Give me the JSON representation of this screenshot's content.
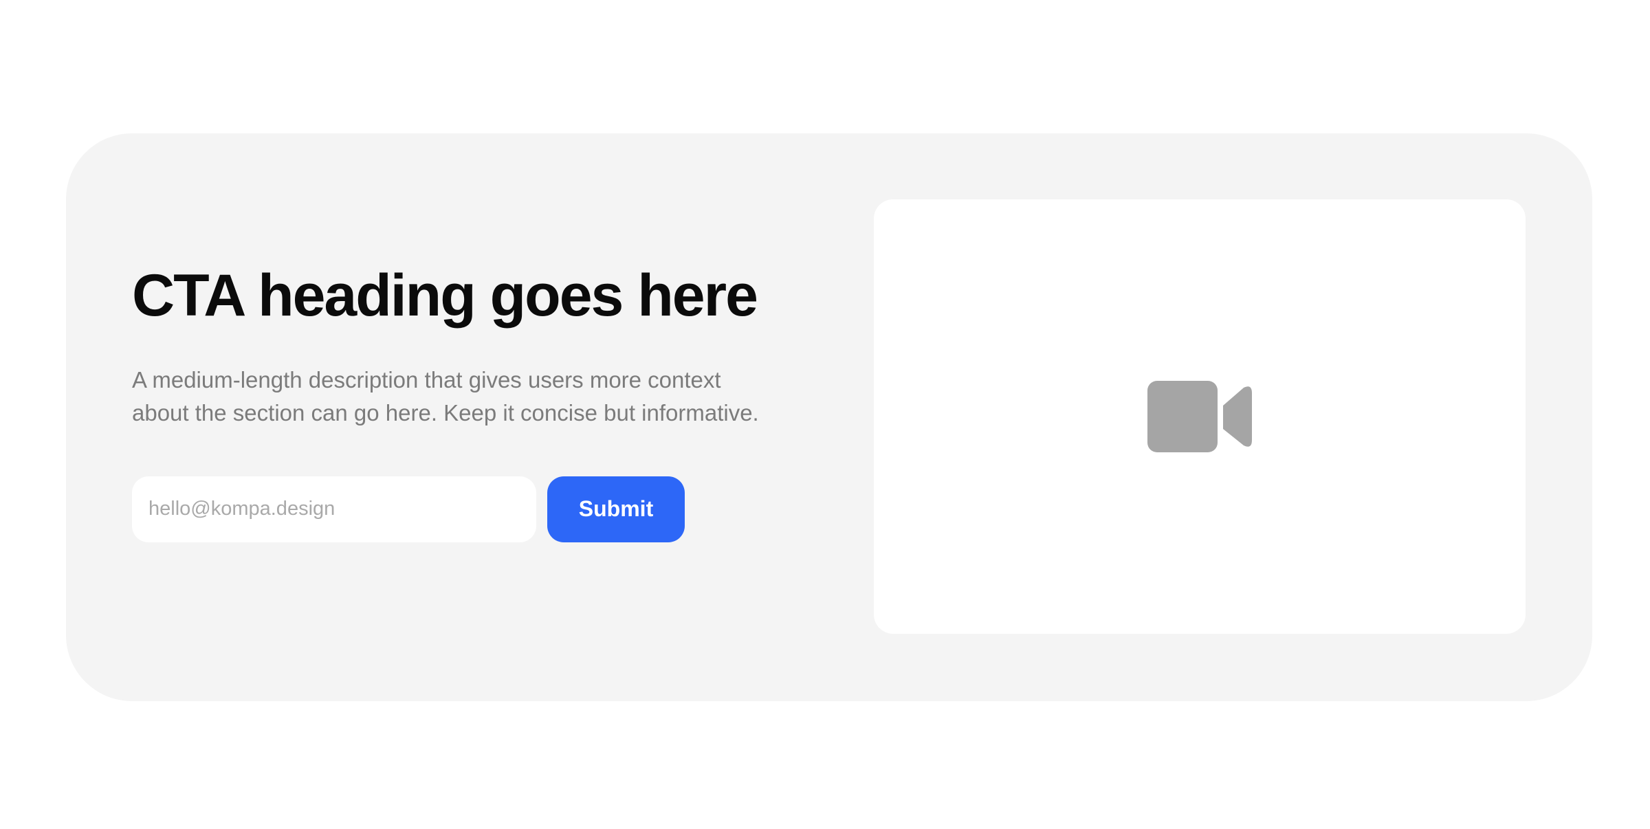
{
  "cta": {
    "heading": "CTA heading goes here",
    "description": "A medium-length description that gives users more context about the section can go here. Keep it concise but informative.",
    "email_input": {
      "placeholder": "hello@kompa.design",
      "value": ""
    },
    "submit_label": "Submit"
  },
  "media": {
    "icon": "video-camera-icon"
  },
  "colors": {
    "page_background": "#ffffff",
    "card_background": "#f4f4f4",
    "heading_text": "#0b0b0b",
    "body_text": "#7b7b7b",
    "placeholder_text": "#a9a9a9",
    "button_background": "#2d67f7",
    "button_text": "#ffffff",
    "icon_fill": "#a5a5a5"
  }
}
